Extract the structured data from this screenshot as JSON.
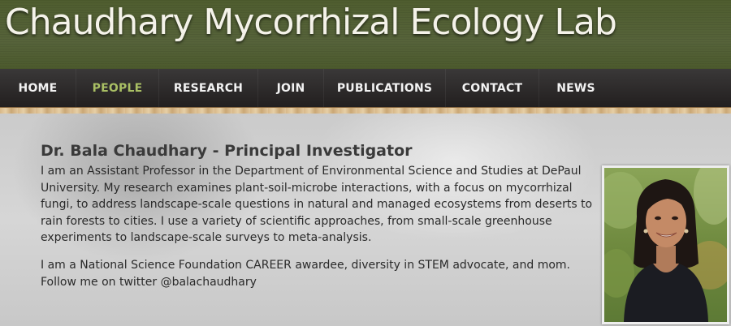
{
  "site": {
    "title": "Chaudhary Mycorrhizal Ecology Lab"
  },
  "nav": {
    "items": [
      {
        "label": "HOME"
      },
      {
        "label": "PEOPLE",
        "active": true
      },
      {
        "label": "RESEARCH"
      },
      {
        "label": "JOIN"
      },
      {
        "label": "PUBLICATIONS"
      },
      {
        "label": "CONTACT"
      },
      {
        "label": "NEWS"
      }
    ],
    "active_color": "#a9bf64"
  },
  "profile": {
    "heading": "Dr. Bala Chaudhary - Principal Investigator",
    "paragraph_1": "I am an Assistant Professor in the Department of Environmental Science and Studies at DePaul University. My research examines plant-soil-microbe interactions, with a focus on mycorrhizal fungi, to address landscape-scale questions in natural and managed ecosystems from deserts to rain forests to cities. I use a variety of scientific approaches, from small-scale greenhouse experiments to landscape-scale surveys to meta-analysis.",
    "paragraph_2": "I am a National Science Foundation CAREER awardee, diversity in STEM advocate, and mom. Follow me on twitter @balachaudhary"
  },
  "colors": {
    "header_green": "#56633a",
    "nav_dark": "#2a2727",
    "title_text": "#f4f2e9"
  }
}
